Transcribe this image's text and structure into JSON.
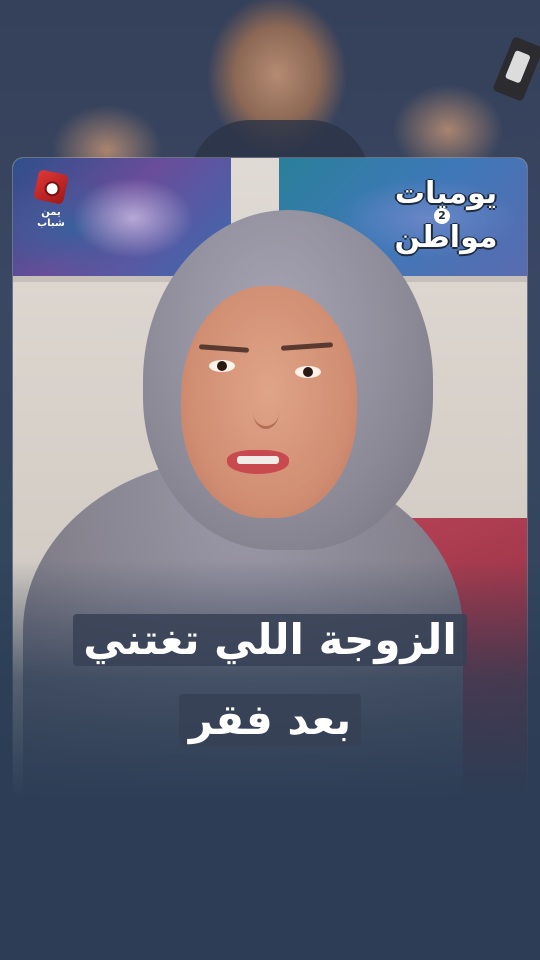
{
  "video": {
    "channel_logo_text": "يمن شباب",
    "show_logo_text": "يوميات مواطن",
    "show_season_badge": "2"
  },
  "caption": {
    "line1": "الزوجة اللي تغتني",
    "line2": "بعد فقر"
  },
  "colors": {
    "background": "#2c3d55",
    "caption_text": "#ffffff",
    "logo_red": "#e03636"
  }
}
